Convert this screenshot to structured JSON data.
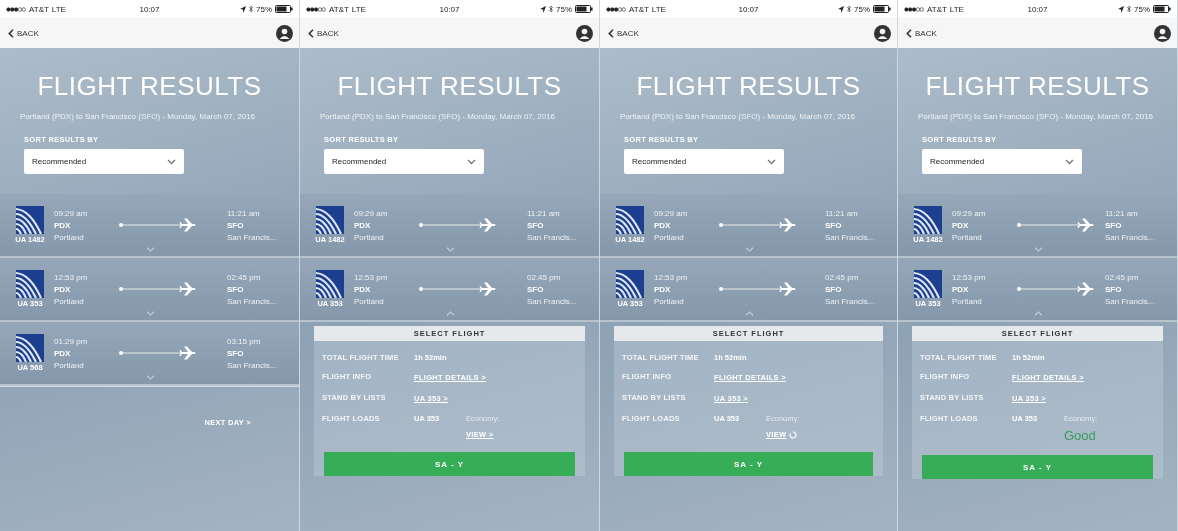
{
  "screens": [
    {
      "status_bar": {
        "carrier": "AT&T",
        "network": "LTE",
        "time": "10:07",
        "battery": "75%"
      },
      "back": "BACK",
      "title": "FLIGHT RESULTS",
      "subtitle": "Portland (PDX) to San Francisco (SFO) - Monday, March 07, 2016",
      "sort_label": "SORT RESULTS BY",
      "sort_value": "Recommended",
      "flights": [
        {
          "flight_no": "UA 1482",
          "depart_time": "09:29 am",
          "origin_code": "PDX",
          "origin_city": "Portland",
          "arrive_time": "11:21 am",
          "dest_code": "SFO",
          "dest_city": "San Francis...",
          "expanded": false
        },
        {
          "flight_no": "UA 353",
          "depart_time": "12:53 pm",
          "origin_code": "PDX",
          "origin_city": "Portland",
          "arrive_time": "02:45 pm",
          "dest_code": "SFO",
          "dest_city": "San Francis...",
          "expanded": false
        },
        {
          "flight_no": "UA 568",
          "depart_time": "01:29 pm",
          "origin_code": "PDX",
          "origin_city": "Portland",
          "arrive_time": "03:15 pm",
          "dest_code": "SFO",
          "dest_city": "San Francis...",
          "expanded": false
        }
      ],
      "next_day": "NEXT DAY >"
    },
    {
      "status_bar": {
        "carrier": "AT&T",
        "network": "LTE",
        "time": "10:07",
        "battery": "75%"
      },
      "back": "BACK",
      "title": "FLIGHT RESULTS",
      "subtitle": "Portland (PDX) to San Francisco (SFO) - Monday, March 07, 2016",
      "sort_label": "SORT RESULTS BY",
      "sort_value": "Recommended",
      "flights": [
        {
          "flight_no": "UA 1482",
          "depart_time": "09:29 am",
          "origin_code": "PDX",
          "origin_city": "Portland",
          "arrive_time": "11:21 am",
          "dest_code": "SFO",
          "dest_city": "San Francis...",
          "expanded": false
        },
        {
          "flight_no": "UA 353",
          "depart_time": "12:53 pm",
          "origin_code": "PDX",
          "origin_city": "Portland",
          "arrive_time": "02:45 pm",
          "dest_code": "SFO",
          "dest_city": "San Francis...",
          "expanded": true,
          "details": {
            "heading": "SELECT FLIGHT",
            "total_label": "TOTAL FLIGHT TIME",
            "total_value": "1h 52min",
            "info_label": "FLIGHT INFO",
            "info_link": "FLIGHT DETAILS >",
            "standby_label": "STAND BY LISTS",
            "standby_link": "UA 353 >",
            "loads_label": "FLIGHT LOADS",
            "loads_flight": "UA 353",
            "loads_cabin": "Economy:",
            "loads_status": {
              "kind": "link",
              "text": "VIEW >"
            },
            "select_button": "SA - Y"
          }
        }
      ]
    },
    {
      "status_bar": {
        "carrier": "AT&T",
        "network": "LTE",
        "time": "10:07",
        "battery": "75%"
      },
      "back": "BACK",
      "title": "FLIGHT RESULTS",
      "subtitle": "Portland (PDX) to San Francisco (SFO) - Monday, March 07, 2016",
      "sort_label": "SORT RESULTS BY",
      "sort_value": "Recommended",
      "flights": [
        {
          "flight_no": "UA 1482",
          "depart_time": "09:29 am",
          "origin_code": "PDX",
          "origin_city": "Portland",
          "arrive_time": "11:21 am",
          "dest_code": "SFO",
          "dest_city": "San Francis...",
          "expanded": false
        },
        {
          "flight_no": "UA 353",
          "depart_time": "12:53 pm",
          "origin_code": "PDX",
          "origin_city": "Portland",
          "arrive_time": "02:45 pm",
          "dest_code": "SFO",
          "dest_city": "San Francis...",
          "expanded": true,
          "details": {
            "heading": "SELECT FLIGHT",
            "total_label": "TOTAL FLIGHT TIME",
            "total_value": "1h 52min",
            "info_label": "FLIGHT INFO",
            "info_link": "FLIGHT DETAILS >",
            "standby_label": "STAND BY LISTS",
            "standby_link": "UA 353 >",
            "loads_label": "FLIGHT LOADS",
            "loads_flight": "UA 353",
            "loads_cabin": "Economy:",
            "loads_status": {
              "kind": "loading",
              "text": "VIEW"
            },
            "select_button": "SA - Y"
          }
        }
      ]
    },
    {
      "status_bar": {
        "carrier": "AT&T",
        "network": "LTE",
        "time": "10:07",
        "battery": "75%"
      },
      "back": "BACK",
      "title": "FLIGHT RESULTS",
      "subtitle": "Portland (PDX) to San Francisco (SFO) - Monday, March 07, 2016",
      "sort_label": "SORT RESULTS BY",
      "sort_value": "Recommended",
      "flights": [
        {
          "flight_no": "UA 1482",
          "depart_time": "09:29 am",
          "origin_code": "PDX",
          "origin_city": "Portland",
          "arrive_time": "11:21 am",
          "dest_code": "SFO",
          "dest_city": "San Francis...",
          "expanded": false
        },
        {
          "flight_no": "UA 353",
          "depart_time": "12:53 pm",
          "origin_code": "PDX",
          "origin_city": "Portland",
          "arrive_time": "02:45 pm",
          "dest_code": "SFO",
          "dest_city": "San Francis...",
          "expanded": true,
          "details": {
            "heading": "SELECT FLIGHT",
            "total_label": "TOTAL FLIGHT TIME",
            "total_value": "1h 52min",
            "info_label": "FLIGHT INFO",
            "info_link": "FLIGHT DETAILS >",
            "standby_label": "STAND BY LISTS",
            "standby_link": "UA 353 >",
            "loads_label": "FLIGHT LOADS",
            "loads_flight": "UA 353",
            "loads_cabin": "Economy:",
            "loads_status": {
              "kind": "rating",
              "text": "Good"
            },
            "select_button": "SA - Y"
          }
        }
      ]
    }
  ]
}
